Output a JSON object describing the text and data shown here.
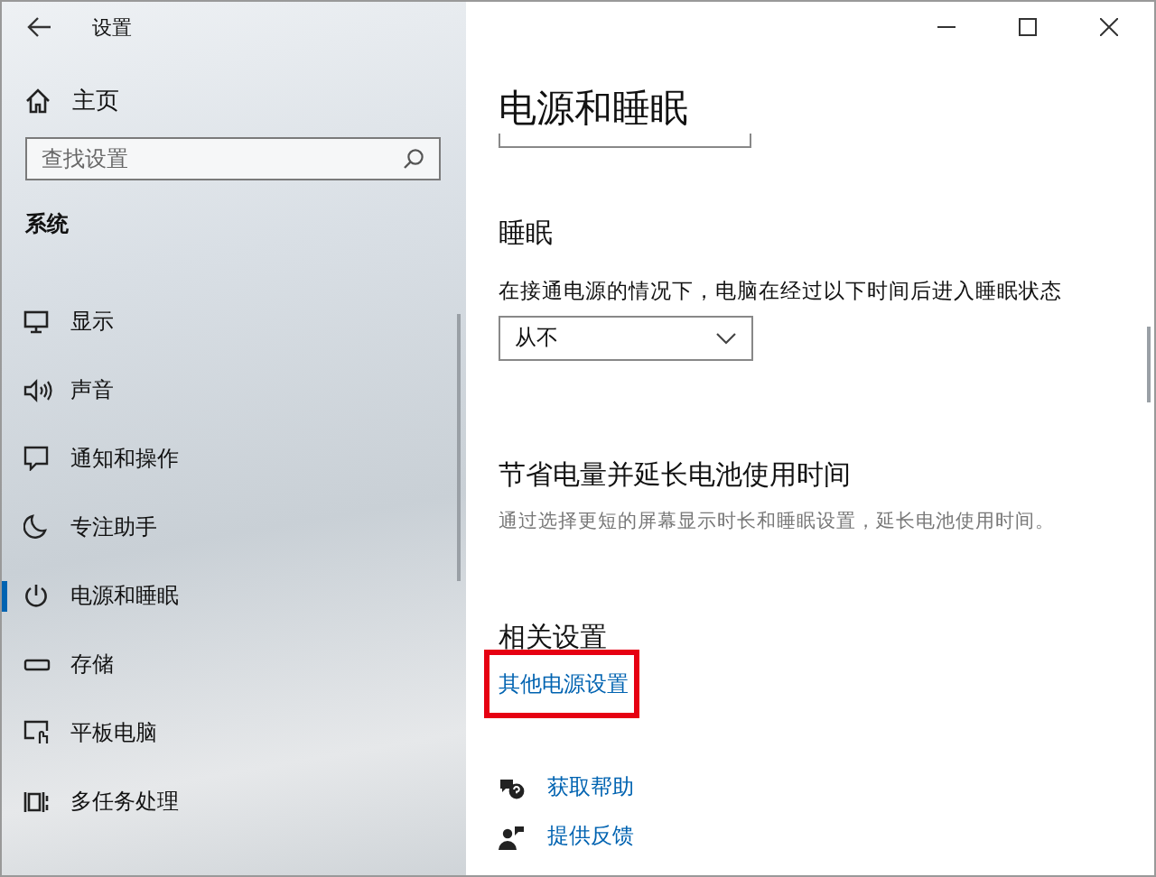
{
  "window": {
    "title": "设置"
  },
  "sidebar": {
    "home": "主页",
    "search": {
      "placeholder": "查找设置"
    },
    "section": "系统",
    "items": [
      {
        "label": "显示",
        "kind": "display",
        "selected": false
      },
      {
        "label": "声音",
        "kind": "sound",
        "selected": false
      },
      {
        "label": "通知和操作",
        "kind": "notify",
        "selected": false
      },
      {
        "label": "专注助手",
        "kind": "moon",
        "selected": false
      },
      {
        "label": "电源和睡眠",
        "kind": "power",
        "selected": true
      },
      {
        "label": "存储",
        "kind": "storage",
        "selected": false
      },
      {
        "label": "平板电脑",
        "kind": "tablet",
        "selected": false
      },
      {
        "label": "多任务处理",
        "kind": "multitask",
        "selected": false
      }
    ]
  },
  "page": {
    "title": "电源和睡眠",
    "sleep": {
      "heading": "睡眠",
      "label": "在接通电源的情况下，电脑在经过以下时间后进入睡眠状态",
      "value": "从不"
    },
    "battery": {
      "heading": "节省电量并延长电池使用时间",
      "text": "通过选择更短的屏幕显示时长和睡眠设置，延长电池使用时间。"
    },
    "related": {
      "heading": "相关设置",
      "link": "其他电源设置",
      "highlighted": true
    },
    "help": [
      {
        "label": "获取帮助",
        "kind": "help"
      },
      {
        "label": "提供反馈",
        "kind": "feedback"
      }
    ]
  }
}
